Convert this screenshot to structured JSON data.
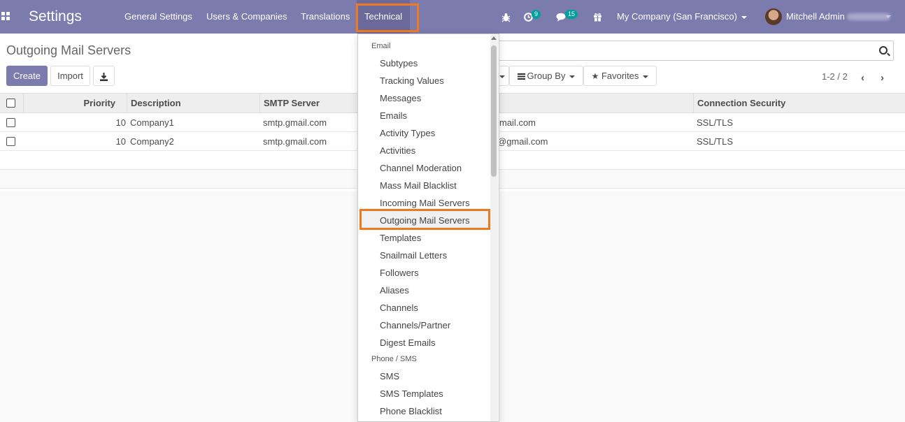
{
  "navbar": {
    "brand": "Settings",
    "menus": [
      "General Settings",
      "Users & Companies",
      "Translations",
      "Technical"
    ],
    "activity_count": "9",
    "messages_count": "15",
    "company": "My Company (San Francisco)",
    "user": "Mitchell Admin",
    "icons": [
      "apps-icon",
      "bug-icon",
      "clock-icon",
      "chat-icon",
      "gift-icon"
    ]
  },
  "control_panel": {
    "breadcrumb": "Outgoing Mail Servers",
    "create_label": "Create",
    "import_label": "Import",
    "group_by_label": "Group By",
    "favorites_label": "Favorites",
    "pager": "1-2 / 2"
  },
  "table": {
    "columns": [
      "Priority",
      "Description",
      "SMTP Server",
      "Connection Security"
    ],
    "rows": [
      {
        "priority": "10",
        "description": "Company1",
        "smtp": "smtp.gmail.com",
        "user_partial": "mail.com",
        "security": "SSL/TLS"
      },
      {
        "priority": "10",
        "description": "Company2",
        "smtp": "smtp.gmail.com",
        "user_partial": "@gmail.com",
        "security": "SSL/TLS"
      }
    ]
  },
  "dropdown": {
    "sections": [
      {
        "header": "Email",
        "items": [
          "Subtypes",
          "Tracking Values",
          "Messages",
          "Emails",
          "Activity Types",
          "Activities",
          "Channel Moderation",
          "Mass Mail Blacklist",
          "Incoming Mail Servers",
          "Outgoing Mail Servers",
          "Templates",
          "Snailmail Letters",
          "Followers",
          "Aliases",
          "Channels",
          "Channels/Partner",
          "Digest Emails"
        ]
      },
      {
        "header": "Phone / SMS",
        "items": [
          "SMS",
          "SMS Templates",
          "Phone Blacklist"
        ]
      }
    ],
    "highlighted": "Outgoing Mail Servers"
  },
  "colors": {
    "navbar": "#7c7bad",
    "highlight_outline": "#f0781e",
    "badge": "#00a09d"
  }
}
